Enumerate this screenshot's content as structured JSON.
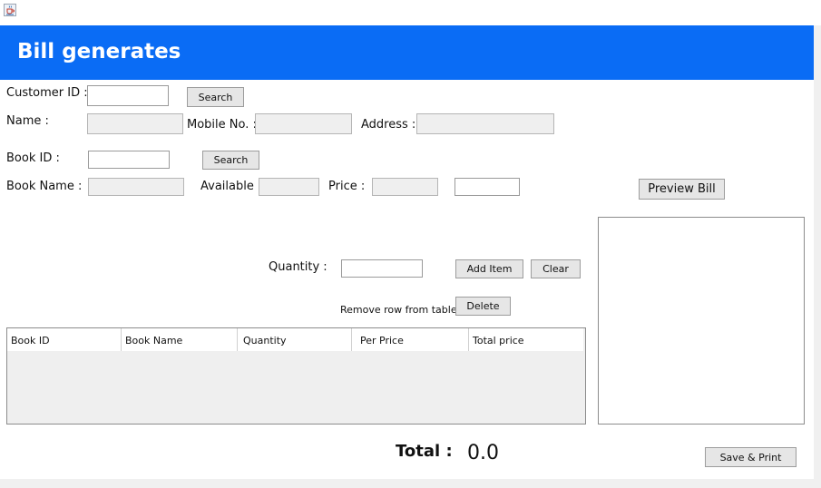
{
  "window": {
    "icon": "java-cup-icon"
  },
  "header": {
    "title": "Bill generates",
    "color": "#0a6cf5"
  },
  "customer": {
    "id_label": "Customer ID :",
    "id_value": "",
    "search_label": "Search",
    "name_label": "Name :",
    "name_value": "",
    "mobile_label": "Mobile No. :",
    "mobile_value": "",
    "address_label": "Address :",
    "address_value": ""
  },
  "book": {
    "id_label": "Book ID :",
    "id_value": "",
    "search_label": "Search",
    "name_label": "Book Name :",
    "name_value": "",
    "available_label": "Available :",
    "available_value": "",
    "price_label": "Price :",
    "price_value": "",
    "extra_value": ""
  },
  "preview": {
    "button_label": "Preview Bill"
  },
  "item": {
    "quantity_label": "Quantity :",
    "quantity_value": "",
    "add_label": "Add Item",
    "clear_label": "Clear",
    "remove_label": "Remove row from table",
    "delete_label": "Delete"
  },
  "table": {
    "columns": [
      "Book ID",
      "Book Name",
      "Quantity",
      "Per Price",
      "Total price"
    ],
    "rows": []
  },
  "footer": {
    "total_label": "Total :",
    "total_value": "0.0",
    "save_label": "Save & Print"
  }
}
